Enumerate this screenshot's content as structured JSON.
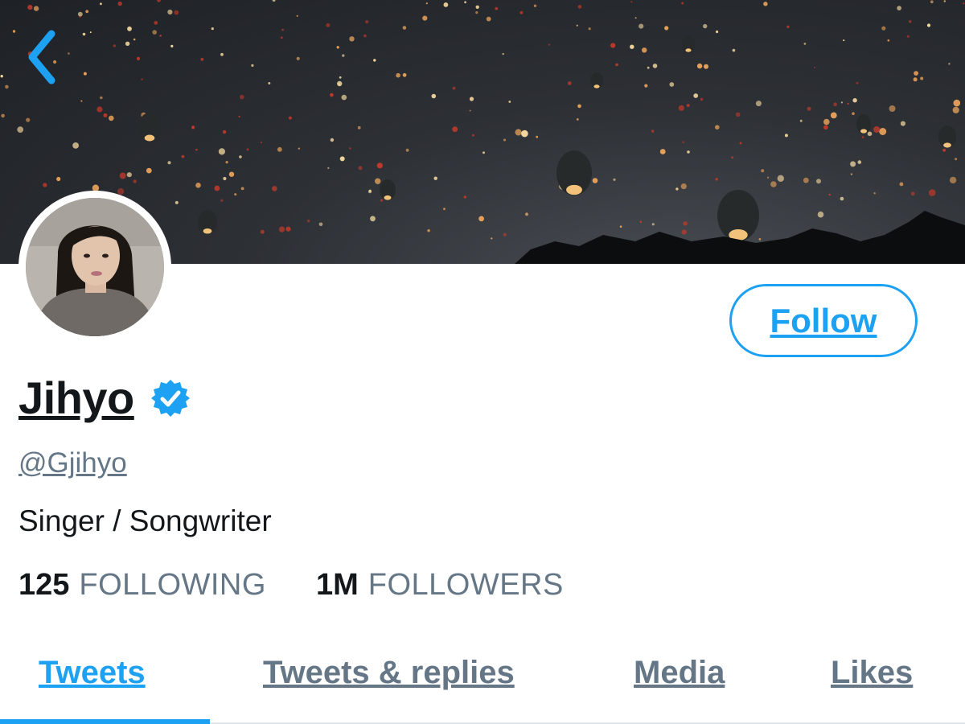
{
  "header": {
    "back_icon": "chevron-left-icon"
  },
  "profile": {
    "display_name": "Jihyo",
    "verified_icon": "verified-badge-icon",
    "handle": "@Gjihyo",
    "bio": "Singer / Songwriter",
    "following_count": "125",
    "following_label": "FOLLOWING",
    "followers_count": "1M",
    "followers_label": "FOLLOWERS"
  },
  "actions": {
    "follow_label": "Follow"
  },
  "tabs": [
    {
      "label": "Tweets",
      "active": true
    },
    {
      "label": "Tweets & replies",
      "active": false
    },
    {
      "label": "Media",
      "active": false
    },
    {
      "label": "Likes",
      "active": false
    }
  ],
  "colors": {
    "accent": "#1da1f2",
    "text_primary": "#14171a",
    "text_secondary": "#657786",
    "banner_sky": "#2d3035"
  }
}
